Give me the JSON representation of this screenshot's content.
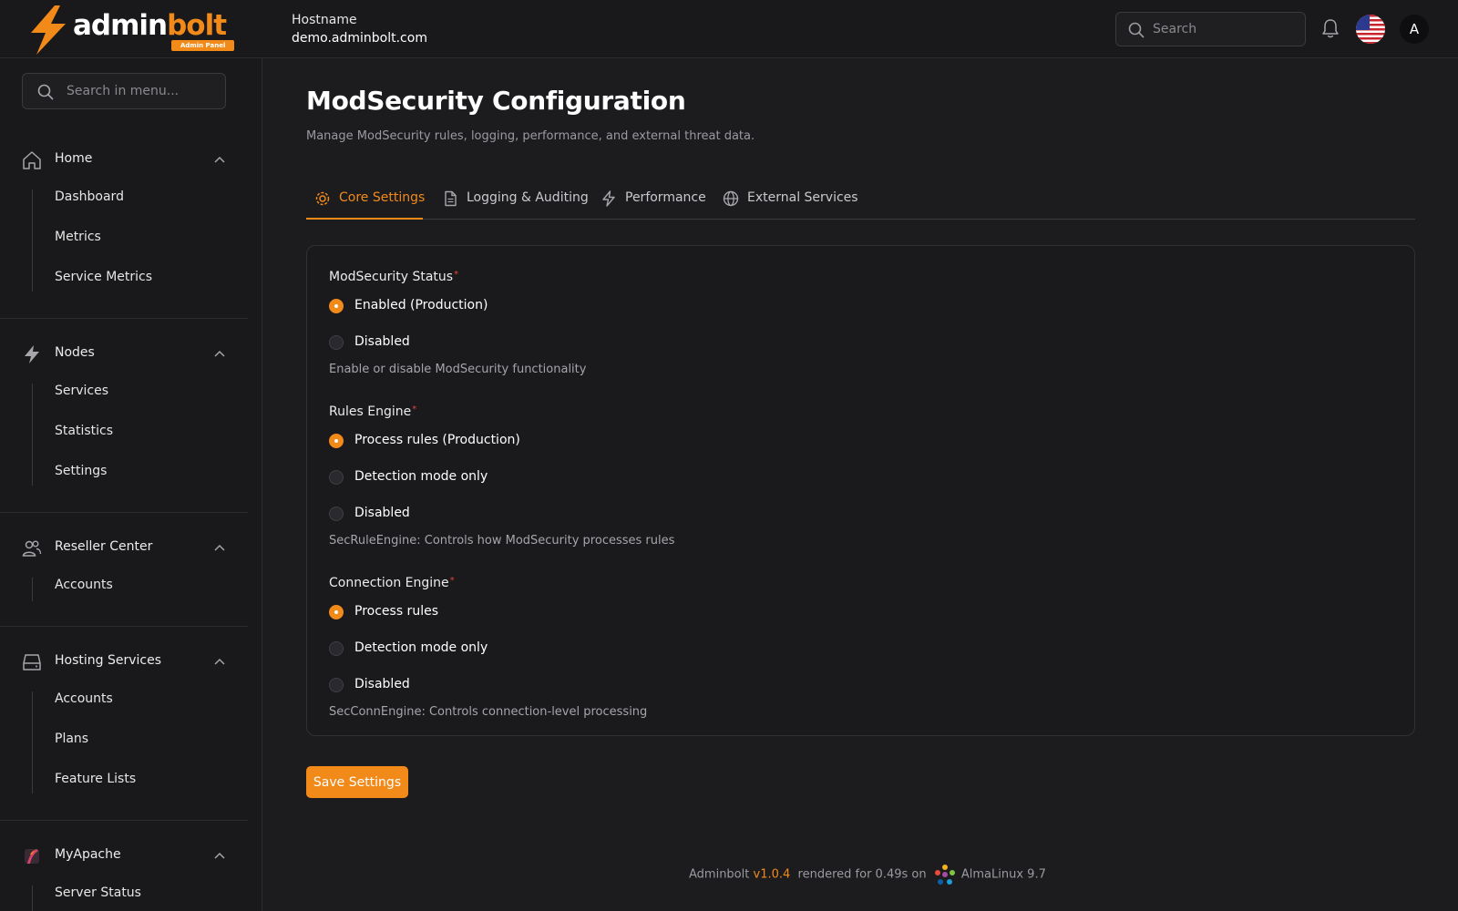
{
  "brand": {
    "name_part1": "admin",
    "name_part2": "bolt",
    "badge": "Admin Panel"
  },
  "header": {
    "hostname_label": "Hostname",
    "hostname_value": "demo.adminbolt.com",
    "search_placeholder": "Search",
    "avatar_initial": "A"
  },
  "sidebar": {
    "search_placeholder": "Search in menu...",
    "groups": [
      {
        "title": "Home",
        "icon": "home-icon",
        "items": [
          "Dashboard",
          "Metrics",
          "Service Metrics"
        ]
      },
      {
        "title": "Nodes",
        "icon": "bolt-icon",
        "items": [
          "Services",
          "Statistics",
          "Settings"
        ]
      },
      {
        "title": "Reseller Center",
        "icon": "users-icon",
        "items": [
          "Accounts"
        ]
      },
      {
        "title": "Hosting Services",
        "icon": "server-icon",
        "items": [
          "Accounts",
          "Plans",
          "Feature Lists"
        ]
      },
      {
        "title": "MyApache",
        "icon": "apache-feather-icon",
        "items": [
          "Server Status"
        ]
      }
    ]
  },
  "page": {
    "title": "ModSecurity Configuration",
    "subtitle": "Manage ModSecurity rules, logging, performance, and external threat data.",
    "tabs": [
      {
        "label": "Core Settings",
        "icon": "gear-icon",
        "active": true
      },
      {
        "label": "Logging & Auditing",
        "icon": "document-icon",
        "active": false
      },
      {
        "label": "Performance",
        "icon": "bolt-icon",
        "active": false
      },
      {
        "label": "External Services",
        "icon": "globe-icon",
        "active": false
      }
    ]
  },
  "form": {
    "modsec_status": {
      "label": "ModSecurity Status",
      "required": "*",
      "options": [
        "Enabled (Production)",
        "Disabled"
      ],
      "selected": "Enabled (Production)",
      "hint": "Enable or disable ModSecurity functionality"
    },
    "rules_engine": {
      "label": "Rules Engine",
      "required": "*",
      "options": [
        "Process rules (Production)",
        "Detection mode only",
        "Disabled"
      ],
      "selected": "Process rules (Production)",
      "hint": "SecRuleEngine: Controls how ModSecurity processes rules"
    },
    "connection_engine": {
      "label": "Connection Engine",
      "required": "*",
      "options": [
        "Process rules",
        "Detection mode only",
        "Disabled"
      ],
      "selected": "Process rules",
      "hint": "SecConnEngine: Controls connection-level processing"
    },
    "save_label": "Save Settings"
  },
  "footer": {
    "product": "Adminbolt",
    "version": "v1.0.4",
    "rendered": "rendered for 0.49s on",
    "os": "AlmaLinux 9.7"
  },
  "colors": {
    "accent": "#f28a1a",
    "background": "#1c1c1f",
    "sidebar": "#19191b",
    "required": "#e0453a"
  }
}
